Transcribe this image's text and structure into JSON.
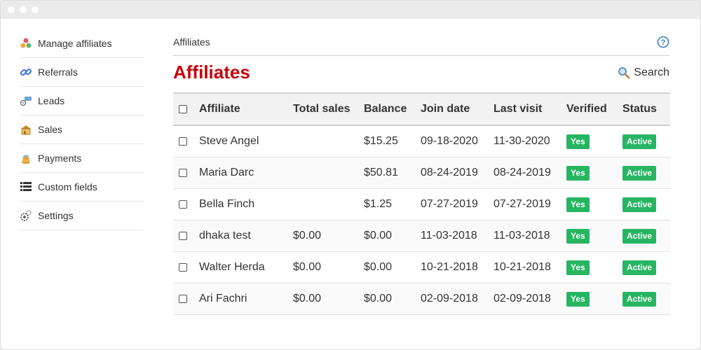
{
  "sidebar": {
    "items": [
      {
        "label": "Manage affiliates",
        "icon": "affiliates-icon"
      },
      {
        "label": "Referrals",
        "icon": "link-icon"
      },
      {
        "label": "Leads",
        "icon": "leads-icon"
      },
      {
        "label": "Sales",
        "icon": "sales-icon"
      },
      {
        "label": "Payments",
        "icon": "payments-icon"
      },
      {
        "label": "Custom fields",
        "icon": "list-icon"
      },
      {
        "label": "Settings",
        "icon": "gear-icon"
      }
    ]
  },
  "header": {
    "breadcrumb": "Affiliates",
    "help_icon": "help-icon",
    "title": "Affiliates",
    "search_label": "Search",
    "search_icon": "search-icon"
  },
  "colors": {
    "title": "#c8000a",
    "badge": "#27b562",
    "help": "#3a7fc1"
  },
  "table": {
    "headers": [
      "Affiliate",
      "Total sales",
      "Balance",
      "Join date",
      "Last visit",
      "Verified",
      "Status"
    ],
    "rows": [
      {
        "affiliate": "Steve Angel",
        "total_sales": "",
        "balance": "$15.25",
        "join_date": "09-18-2020",
        "last_visit": "11-30-2020",
        "verified": "Yes",
        "status": "Active"
      },
      {
        "affiliate": "Maria Darc",
        "total_sales": "",
        "balance": "$50.81",
        "join_date": "08-24-2019",
        "last_visit": "08-24-2019",
        "verified": "Yes",
        "status": "Active"
      },
      {
        "affiliate": "Bella Finch",
        "total_sales": "",
        "balance": "$1.25",
        "join_date": "07-27-2019",
        "last_visit": "07-27-2019",
        "verified": "Yes",
        "status": "Active"
      },
      {
        "affiliate": "dhaka test",
        "total_sales": "$0.00",
        "balance": "$0.00",
        "join_date": "11-03-2018",
        "last_visit": "11-03-2018",
        "verified": "Yes",
        "status": "Active"
      },
      {
        "affiliate": "Walter Herda",
        "total_sales": "$0.00",
        "balance": "$0.00",
        "join_date": "10-21-2018",
        "last_visit": "10-21-2018",
        "verified": "Yes",
        "status": "Active"
      },
      {
        "affiliate": "Ari Fachri",
        "total_sales": "$0.00",
        "balance": "$0.00",
        "join_date": "02-09-2018",
        "last_visit": "02-09-2018",
        "verified": "Yes",
        "status": "Active"
      }
    ]
  }
}
